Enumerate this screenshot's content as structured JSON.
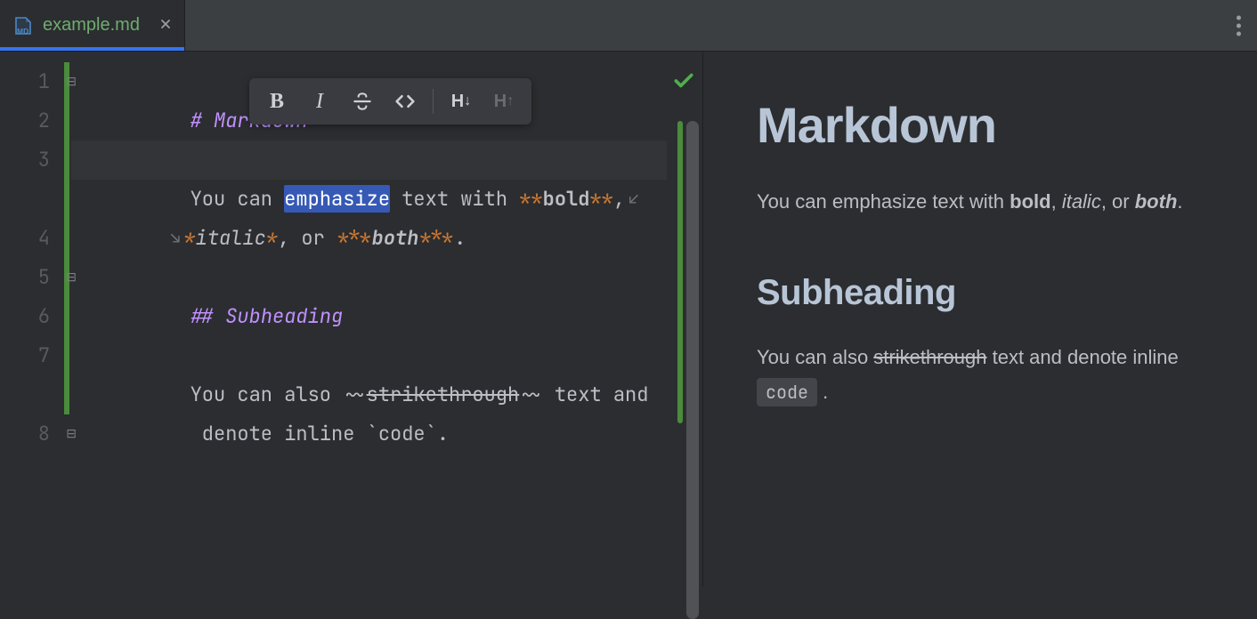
{
  "tab": {
    "filename": "example.md",
    "icon": "markdown-file-icon"
  },
  "toolbar": {
    "bold": "B",
    "italic": "I",
    "strike": "S",
    "code": "<>",
    "h_inc": "H↓",
    "h_dec": "H↑"
  },
  "gutter": {
    "lines": [
      "1",
      "2",
      "3",
      "4",
      "5",
      "6",
      "7",
      "8"
    ]
  },
  "source": {
    "l1": {
      "hash": "# ",
      "title": "Markdown"
    },
    "l3": {
      "pre": "You can ",
      "sel": "emphasize",
      "mid": " text with ",
      "bmk": "**",
      "bold": "bold",
      "bmk2": "**",
      "comma": ","
    },
    "l3b": {
      "imk": "*",
      "italic": "italic",
      "imk2": "*",
      "sep": ", or ",
      "bimk": "***",
      "both": "both",
      "bimk2": "***",
      "dot": "."
    },
    "l5": {
      "hash": "## ",
      "title": "Subheading"
    },
    "l7": {
      "pre": "You can also ",
      "smk": "~~",
      "strike": "strikethrough",
      "smk2": "~~",
      "mid": " text and"
    },
    "l7b": {
      "pre": " denote inline ",
      "tick": "`",
      "code": "code",
      "tick2": "`",
      "dot": "."
    }
  },
  "preview": {
    "h1": "Markdown",
    "p1": {
      "a": "You can emphasize text with ",
      "bold": "bold",
      "b": ", ",
      "italic": "italic",
      "c": ", or ",
      "both": "both",
      "d": "."
    },
    "h2": "Subheading",
    "p2": {
      "a": "You can also ",
      "strike": "strikethrough",
      "b": " text and denote inline ",
      "code": "code",
      "c": " ."
    }
  }
}
